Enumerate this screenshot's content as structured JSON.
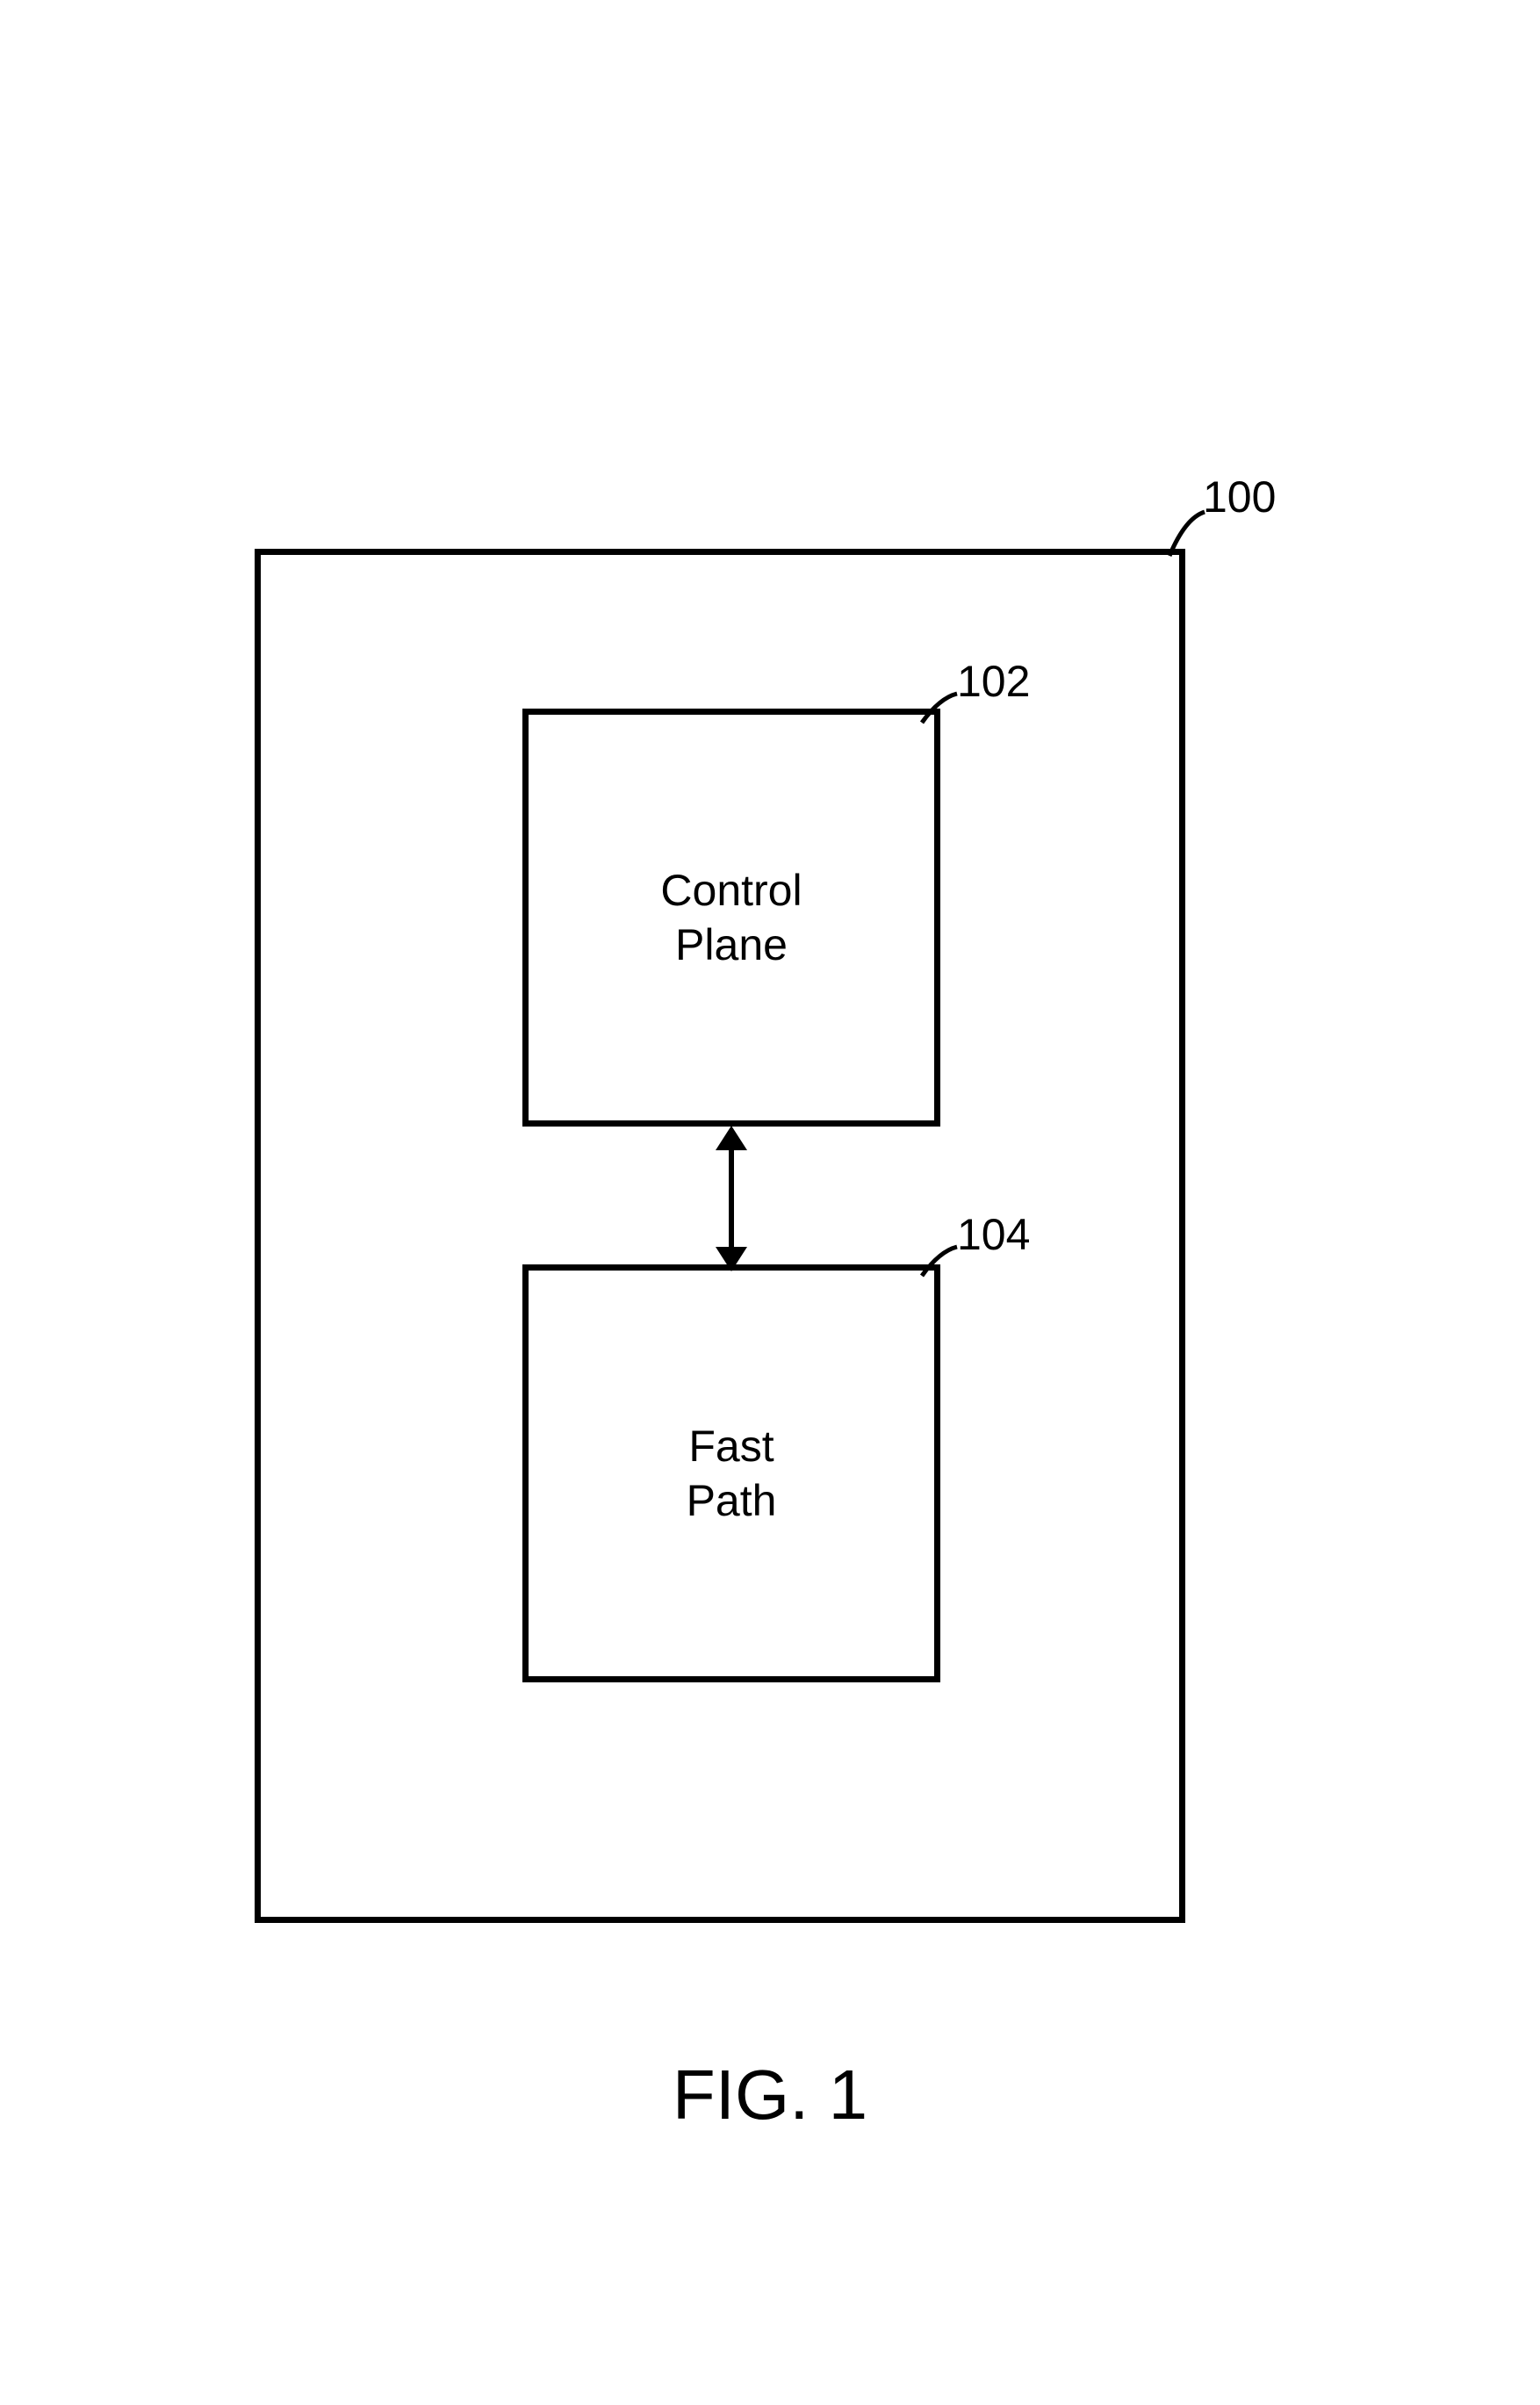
{
  "figure": {
    "caption": "FIG. 1"
  },
  "boxes": {
    "controlPlane": {
      "line1": "Control",
      "line2": "Plane"
    },
    "fastPath": {
      "line1": "Fast",
      "line2": "Path"
    }
  },
  "references": {
    "outer": "100",
    "controlPlane": "102",
    "fastPath": "104"
  }
}
